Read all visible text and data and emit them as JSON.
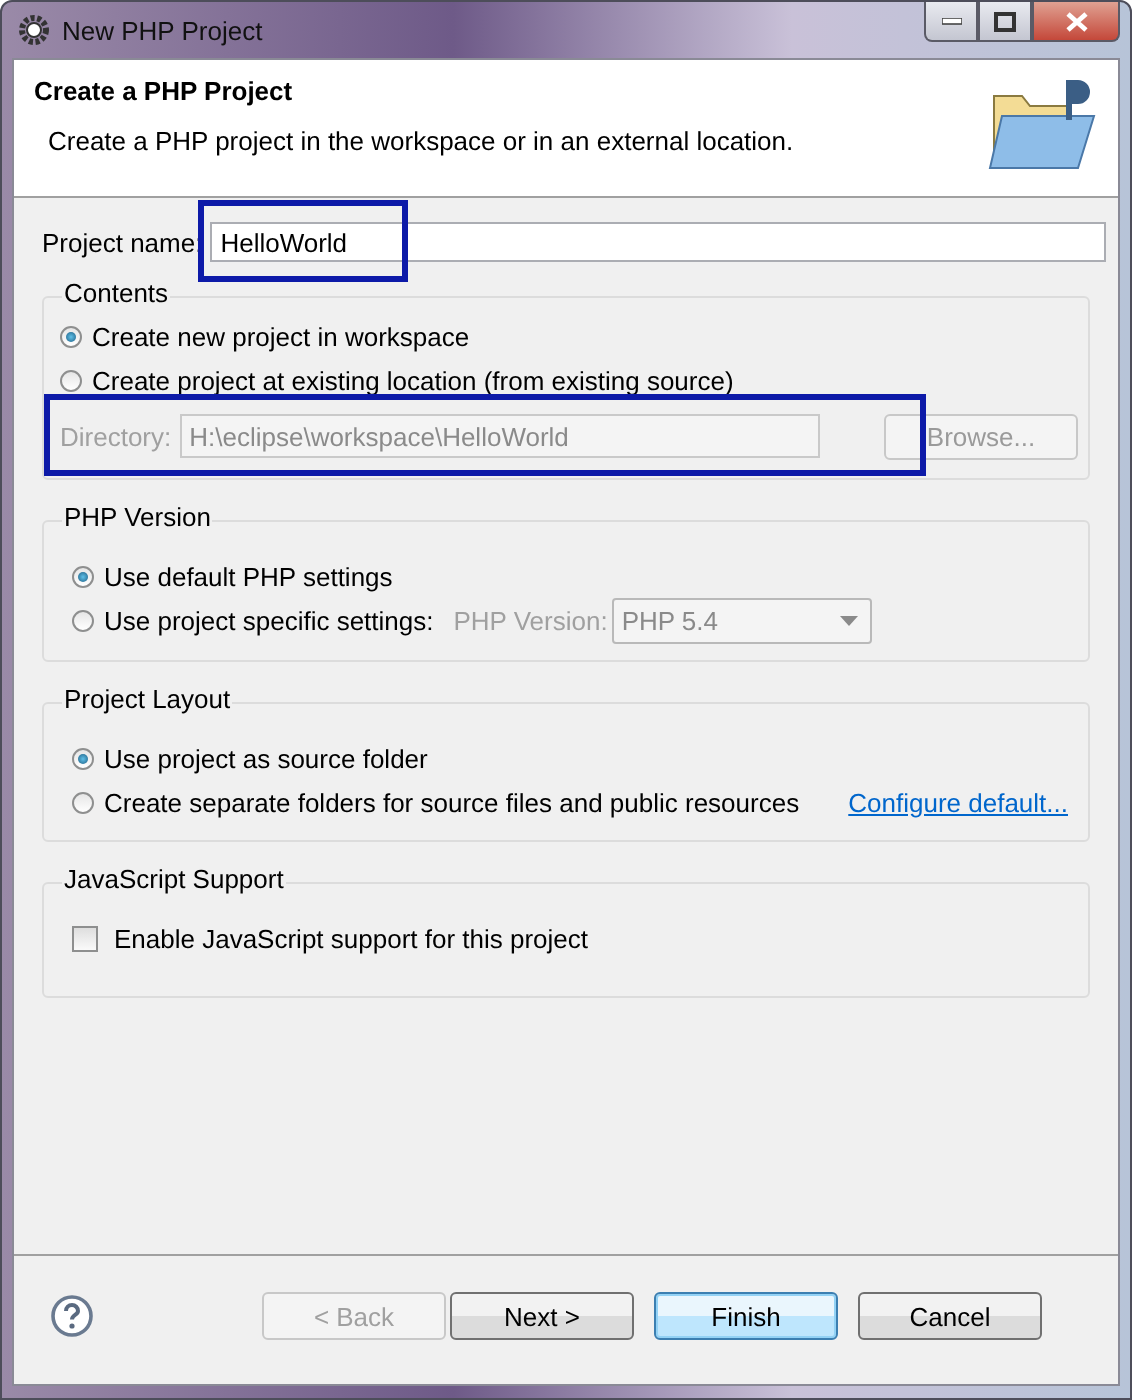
{
  "window": {
    "title": "New PHP Project"
  },
  "header": {
    "title": "Create a PHP Project",
    "description": "Create a PHP project in the workspace or in an external location."
  },
  "project_name": {
    "label": "Project name:",
    "value": "HelloWorld",
    "highlighted": true
  },
  "contents": {
    "title": "Contents",
    "options": [
      {
        "label": "Create new project in workspace",
        "selected": true
      },
      {
        "label": "Create project at existing location (from existing source)",
        "selected": false
      }
    ],
    "directory": {
      "label": "Directory:",
      "value": "H:\\eclipse\\workspace\\HelloWorld",
      "disabled": true,
      "highlighted": true
    },
    "browse_button": {
      "label": "Browse...",
      "disabled": true
    }
  },
  "php_version": {
    "title": "PHP Version",
    "options": [
      {
        "label": "Use default PHP settings",
        "selected": true
      },
      {
        "label": "Use project specific settings:",
        "selected": false
      }
    ],
    "version_label": "PHP Version:",
    "version_select": {
      "value": "PHP 5.4",
      "disabled": true
    }
  },
  "project_layout": {
    "title": "Project Layout",
    "options": [
      {
        "label": "Use project as source folder",
        "selected": true
      },
      {
        "label": "Create separate folders for source files and public resources",
        "selected": false
      }
    ],
    "link": "Configure default..."
  },
  "javascript_support": {
    "title": "JavaScript Support",
    "checkbox": {
      "label": "Enable JavaScript support for this project",
      "checked": false
    }
  },
  "buttons": [
    {
      "label": "< Back",
      "disabled": true,
      "default": false
    },
    {
      "label": "Next >",
      "disabled": false,
      "default": false
    },
    {
      "label": "Finish",
      "disabled": false,
      "default": true
    },
    {
      "label": "Cancel",
      "disabled": false,
      "default": false
    }
  ]
}
